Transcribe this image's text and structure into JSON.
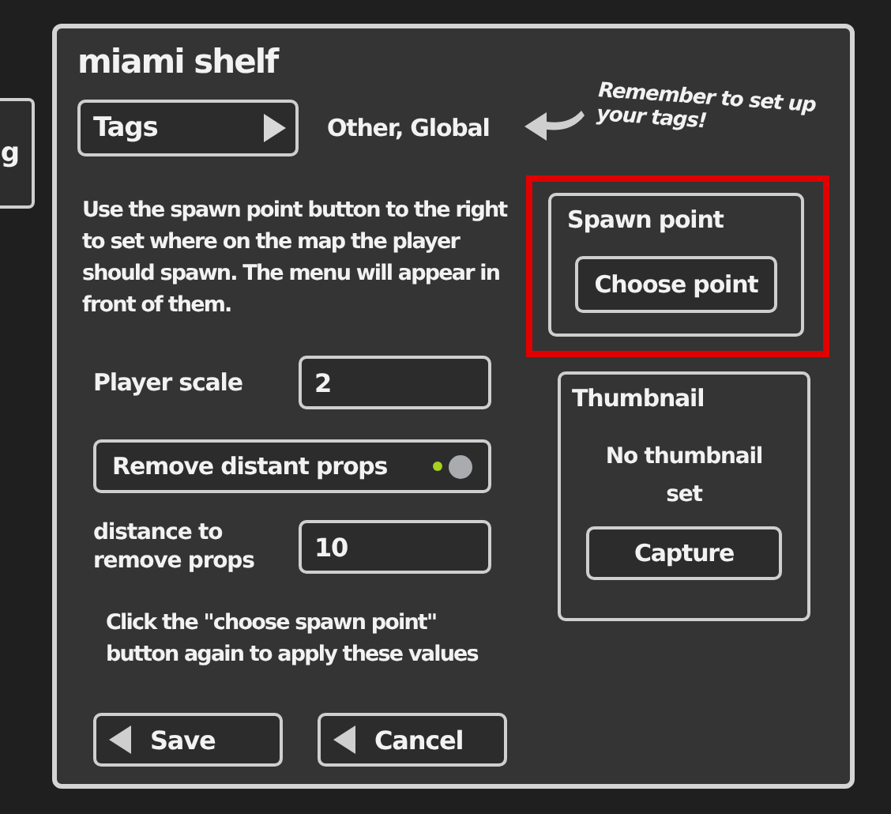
{
  "background_panel": {
    "text": "g"
  },
  "window": {
    "title": "miami shelf"
  },
  "tags": {
    "button": "Tags",
    "value": "Other, Global",
    "hint": "Remember to set up your tags!"
  },
  "instructions": "Use the spawn point button to the right to set where on the map the player should spawn. The menu will appear in front of them.",
  "player_scale": {
    "label": "Player scale",
    "value": "2"
  },
  "remove_distant_props": {
    "label": "Remove distant props",
    "on": true
  },
  "distance": {
    "label": "distance to remove props",
    "value": "10"
  },
  "apply_note": "Click the \"choose spawn point\" button again to apply these values",
  "spawn_point": {
    "title": "Spawn point",
    "button": "Choose point",
    "highlighted": true
  },
  "thumbnail": {
    "title": "Thumbnail",
    "status": "No thumbnail set",
    "button": "Capture"
  },
  "buttons": [
    {
      "label": "Save"
    },
    {
      "label": "Cancel"
    }
  ]
}
